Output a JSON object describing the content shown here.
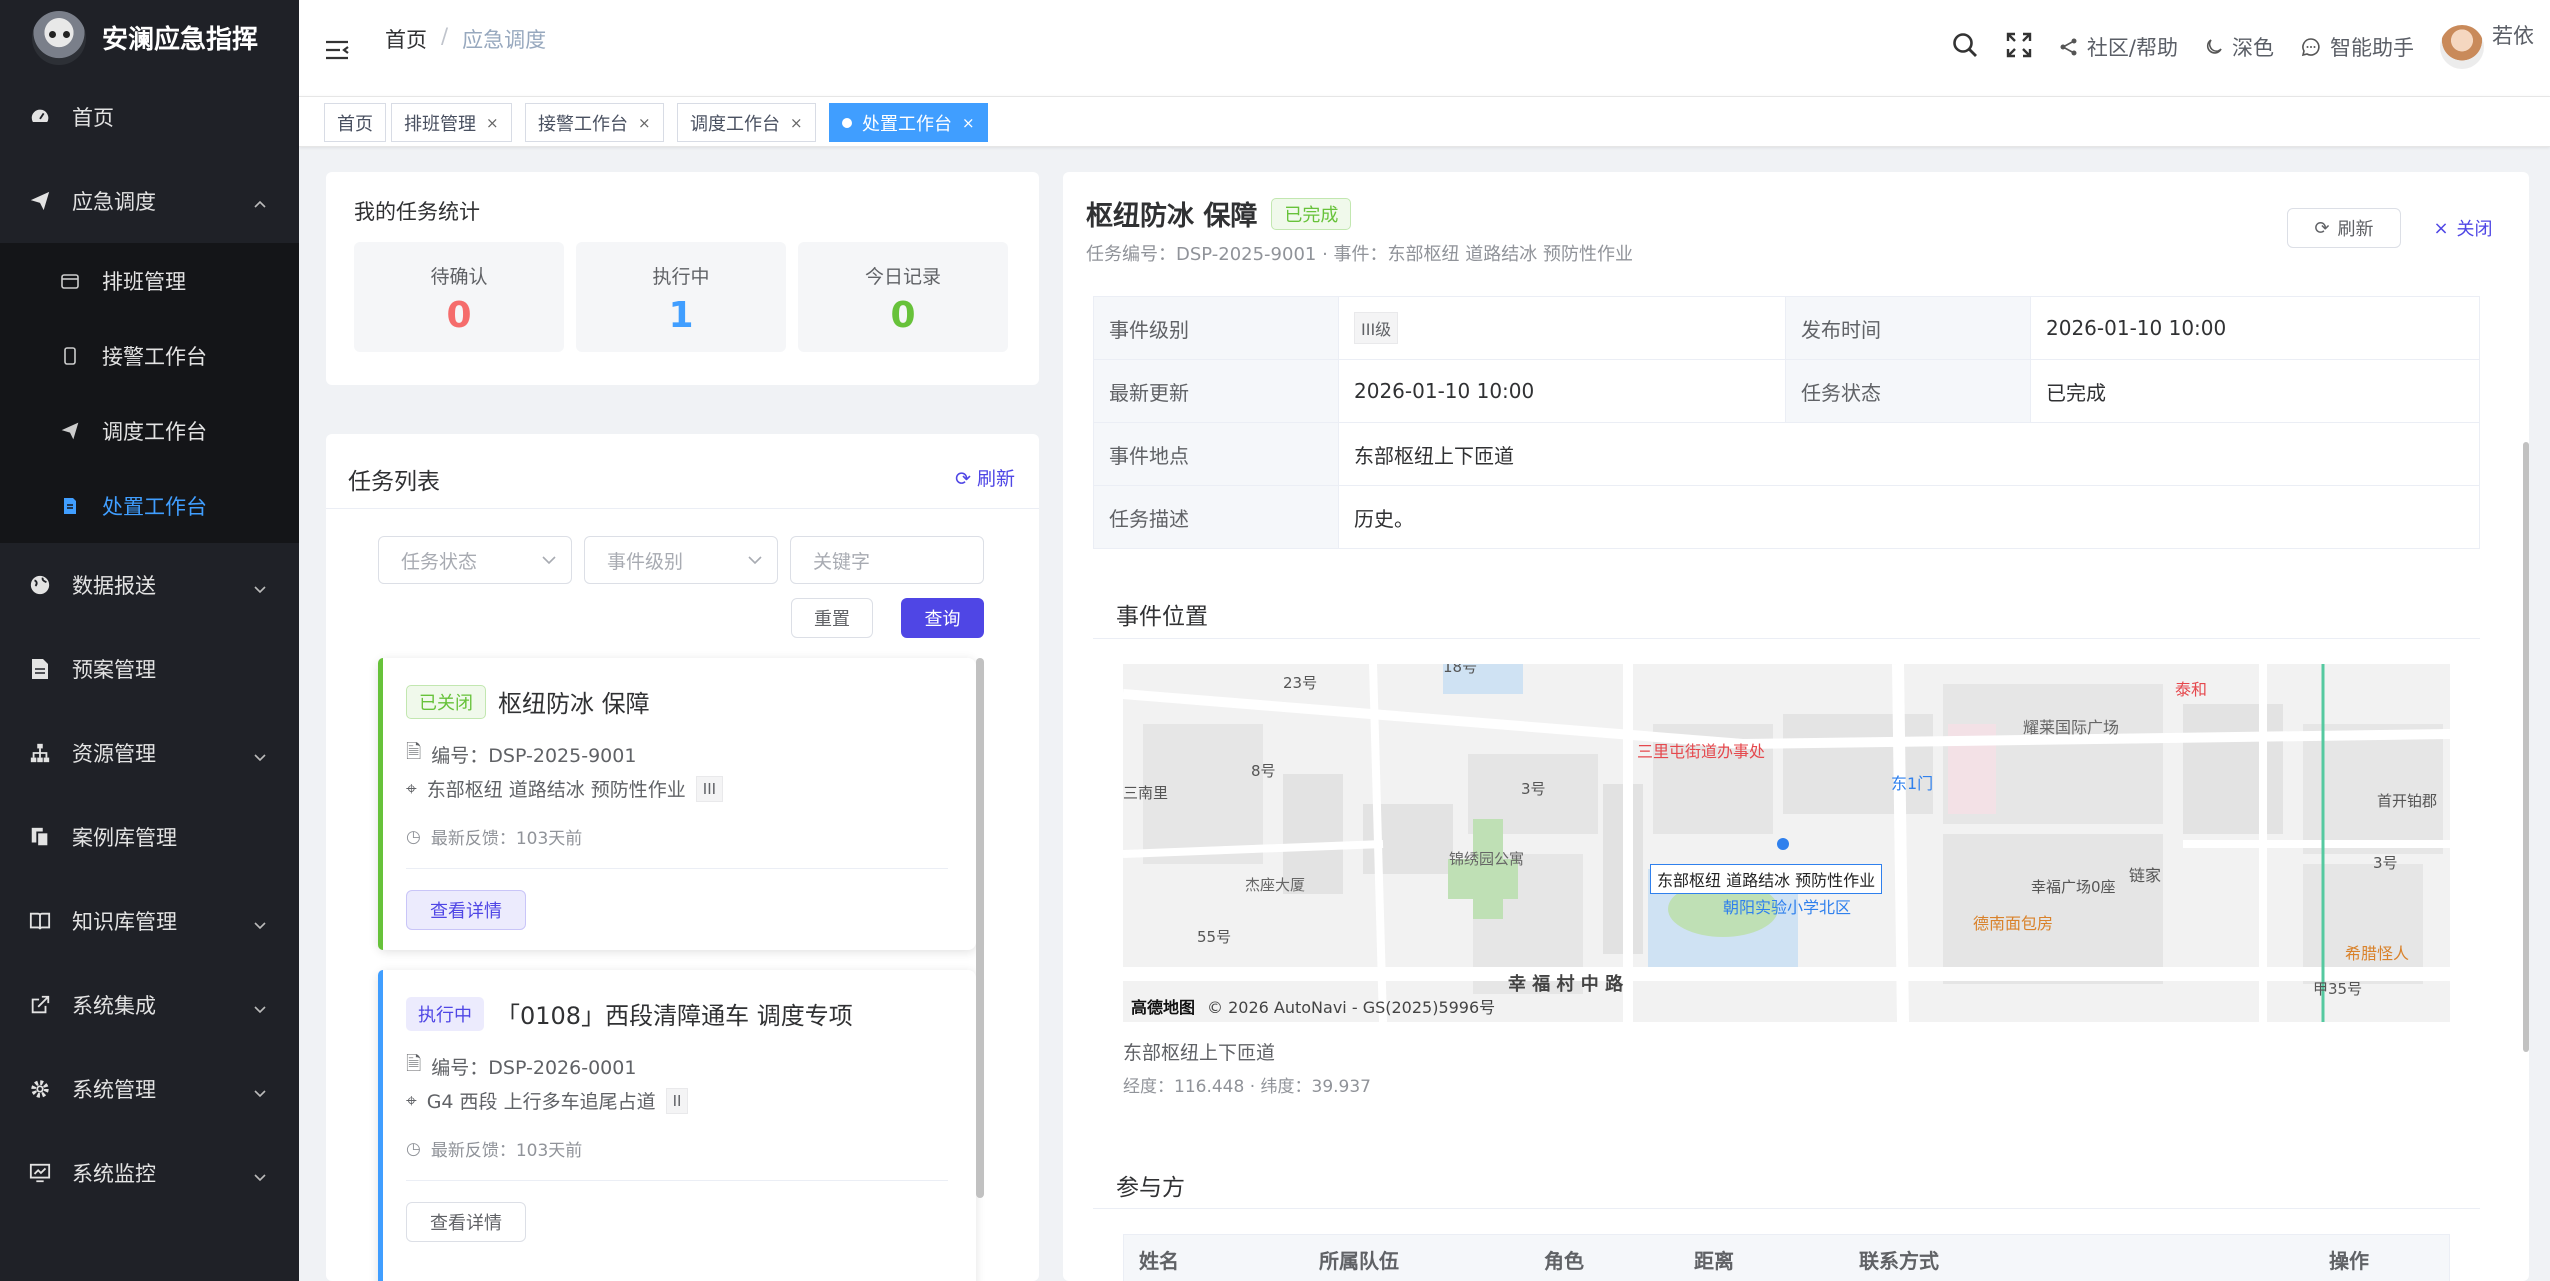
{
  "app": {
    "name": "安澜应急指挥"
  },
  "sidebar": {
    "items": [
      {
        "label": "首页"
      },
      {
        "label": "应急调度"
      },
      {
        "label": "数据报送"
      },
      {
        "label": "预案管理"
      },
      {
        "label": "资源管理"
      },
      {
        "label": "案例库管理"
      },
      {
        "label": "知识库管理"
      },
      {
        "label": "系统集成"
      },
      {
        "label": "系统管理"
      },
      {
        "label": "系统监控"
      }
    ],
    "sub_items": [
      {
        "label": "排班管理"
      },
      {
        "label": "接警工作台"
      },
      {
        "label": "调度工作台"
      },
      {
        "label": "处置工作台"
      }
    ]
  },
  "header": {
    "breadcrumb": [
      "首页",
      "/",
      "应急调度"
    ],
    "community": "社区/帮助",
    "theme": "深色",
    "assistant": "智能助手",
    "user": "若依"
  },
  "tabs": [
    {
      "label": "首页"
    },
    {
      "label": "排班管理",
      "close": "×"
    },
    {
      "label": "接警工作台",
      "close": "×"
    },
    {
      "label": "调度工作台",
      "close": "×"
    },
    {
      "label": "处置工作台",
      "close": "×"
    }
  ],
  "stats": {
    "title": "我的任务统计",
    "items": [
      {
        "label": "待确认",
        "value": "0",
        "color": "#f56c6c"
      },
      {
        "label": "执行中",
        "value": "1",
        "color": "#409eff"
      },
      {
        "label": "今日记录",
        "value": "0",
        "color": "#67c23a"
      }
    ]
  },
  "tasks": {
    "title": "任务列表",
    "refresh": "刷新",
    "filters": {
      "status": "任务状态",
      "level": "事件级别",
      "keyword": "关键字"
    },
    "reset": "重置",
    "query": "查询",
    "cards": [
      {
        "status": "已关闭",
        "title": "枢纽防冰 保障",
        "code": "编号：DSP-2025-9001",
        "event": "东部枢纽 道路结冰 预防性作业",
        "level": "III",
        "feedback": "最新反馈：103天前",
        "button": "查看详情"
      },
      {
        "status": "执行中",
        "title": "「0108」西段清障通车 调度专项",
        "code": "编号：DSP-2026-0001",
        "event": "G4 西段 上行多车追尾占道",
        "level": "II",
        "feedback": "最新反馈：103天前",
        "button": "查看详情"
      }
    ]
  },
  "detail": {
    "title": "枢纽防冰 保障",
    "status": "已完成",
    "subtitle": "任务编号：DSP-2025-9001 · 事件：东部枢纽 道路结冰 预防性作业",
    "refresh": "刷新",
    "close": "关闭",
    "fields": {
      "level_label": "事件级别",
      "level": "III级",
      "publish_label": "发布时间",
      "publish": "2026-01-10 10:00",
      "update_label": "最新更新",
      "update": "2026-01-10 10:00",
      "status_label": "任务状态",
      "status": "已完成",
      "location_label": "事件地点",
      "location": "东部枢纽上下匝道",
      "desc_label": "任务描述",
      "desc": "历史。"
    },
    "map_section": "事件位置",
    "map": {
      "marker_label": "东部枢纽 道路结冰 预防性作业",
      "labels": [
        "18号",
        "23号",
        "三里屯街道办事处",
        "东1门",
        "耀莱国际广场",
        "8号",
        "3号",
        "锦绣园公寓",
        "杰座大厦",
        "55号",
        "朝阳实验小学北区",
        "德南面包房",
        "幸福广场0座",
        "链家",
        "3号",
        "希腊怪人",
        "甲35号",
        "首开铂郡",
        "幸 福 村 中 路",
        "泰和",
        "三南里"
      ],
      "attribution": "高德地图",
      "copyright": "© 2026 AutoNavi - GS(2025)5996号"
    },
    "location_text": "东部枢纽上下匝道",
    "coords": "经度：116.448 · 纬度：39.937",
    "participants_section": "参与方",
    "participant_columns": [
      "姓名",
      "所属队伍",
      "角色",
      "距离",
      "联系方式",
      "操作"
    ]
  }
}
